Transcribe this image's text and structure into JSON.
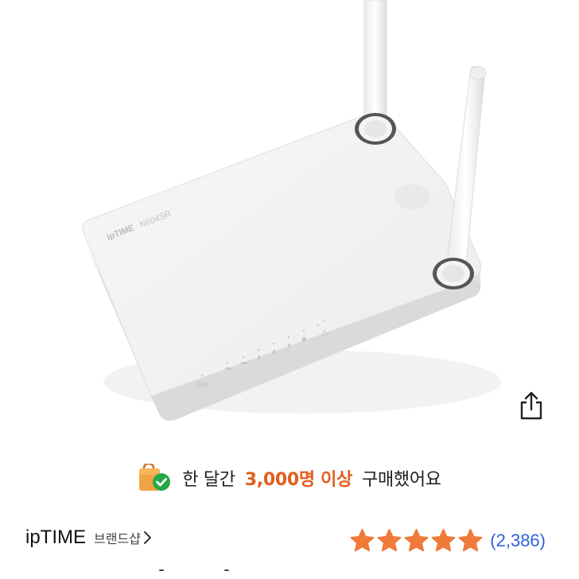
{
  "product": {
    "image_alt": "ipTIME N604SR wireless router",
    "device_logo": "ipTIME",
    "device_model": "N604SR"
  },
  "banner": {
    "text_before": "한 달간",
    "highlight": "3,000명 이상",
    "text_after": "구매했어요",
    "icon": "shopping-bag-check-icon",
    "highlight_color": "#e35d1c"
  },
  "brand": {
    "name": "ipTIME",
    "shop_label": "브랜드샵"
  },
  "rating": {
    "stars": 5,
    "max_stars": 5,
    "review_count": "(2,386)",
    "star_color": "#f07a3a"
  },
  "share": {
    "icon": "share-icon"
  }
}
